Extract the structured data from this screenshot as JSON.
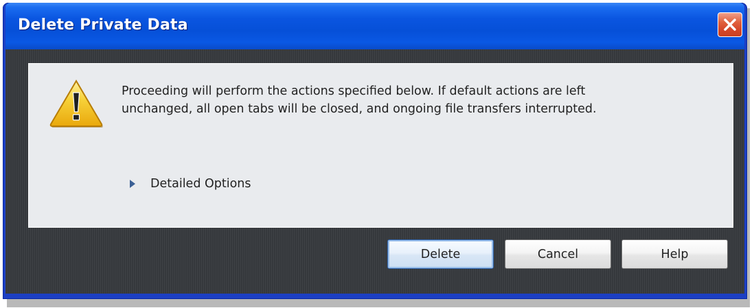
{
  "window": {
    "title": "Delete Private Data"
  },
  "dialog": {
    "message_lines": [
      "Proceeding will perform the actions specified below. If default actions are left",
      "unchanged, all open tabs will be closed, and ongoing file transfers interrupted."
    ],
    "details_label": "Detailed Options",
    "details_expanded": false
  },
  "buttons": {
    "delete_label": "Delete",
    "cancel_label": "Cancel",
    "help_label": "Help",
    "default": "delete"
  },
  "icons": {
    "warning": "warning-icon",
    "expander": "triangle-right-icon",
    "close": "close-icon"
  },
  "colors": {
    "titlebar": "#0a55e0",
    "close_button": "#d5482a",
    "client_background": "#3a3d41",
    "panel_background": "#e9ebee",
    "warning_yellow": "#f2c018"
  }
}
